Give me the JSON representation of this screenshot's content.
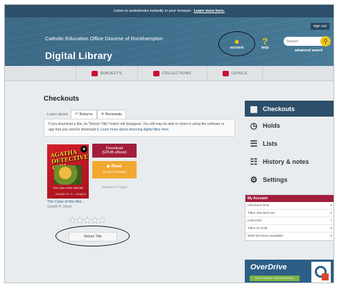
{
  "topbar": {
    "text": "Listen to audiobooks instantly in your browser.",
    "link": "Learn more here."
  },
  "header": {
    "signout": "sign out",
    "org": "Catholic Education Office Diocese of Rockhampton",
    "library": "Digital Library",
    "account_label": "account",
    "help_label": "help",
    "search_placeholder": "Search",
    "advanced_search": "advanced search"
  },
  "nav": {
    "subjects": "SUBJECTS",
    "collections": "COLLECTIONS",
    "levels": "LEVELS"
  },
  "page": {
    "title": "Checkouts",
    "tabs": {
      "learn": "Learn about",
      "returns": "Returns",
      "renewals": "Renewals"
    },
    "notice": "If you download a title, its \"Return Title\" button will disappear. You still may be able to return it using the software or app that you used to download it.",
    "notice_link": "Learn more about returning digital titles here."
  },
  "book": {
    "cover_title": "AGATHA DETECTIVE GIRL",
    "cover_sub": "The Case of the Wild Bill",
    "cover_author": "GARETH P. JONES",
    "title": "The Case of the Mis...",
    "author": "Gareth P. Jones",
    "download_label": "Download",
    "download_sub": "(EPUB eBook)",
    "read_label": "Read",
    "read_sub": "(in your browser)",
    "expires": "Expires in 7 days",
    "return_label": "Return Title",
    "rating": 0,
    "max_rating": 5
  },
  "sidebar": {
    "items": [
      {
        "label": "Checkouts",
        "icon": "books-icon",
        "active": true
      },
      {
        "label": "Holds",
        "icon": "clock-icon",
        "active": false
      },
      {
        "label": "Lists",
        "icon": "list-icon",
        "active": false
      },
      {
        "label": "History & notes",
        "icon": "history-icon",
        "active": false
      },
      {
        "label": "Settings",
        "icon": "gear-icon",
        "active": false
      }
    ]
  },
  "account": {
    "title": "My Account:",
    "rows": [
      {
        "label": "Checkout limit:",
        "value": "2"
      },
      {
        "label": "Titles checked out:",
        "value": "1"
      },
      {
        "label": "Hold limit:",
        "value": "7"
      },
      {
        "label": "Titles on hold:",
        "value": "0"
      },
      {
        "label": "Wish list items available:",
        "value": "0"
      }
    ]
  },
  "overdrive": {
    "name": "OverDrive",
    "sub": "SOFTWARE RESOURCES"
  },
  "colors": {
    "header": "#3f6f8c",
    "topbar": "#2d4f69",
    "accent": "#a31d3c",
    "read": "#f1a830",
    "yellow": "#f0c419"
  }
}
